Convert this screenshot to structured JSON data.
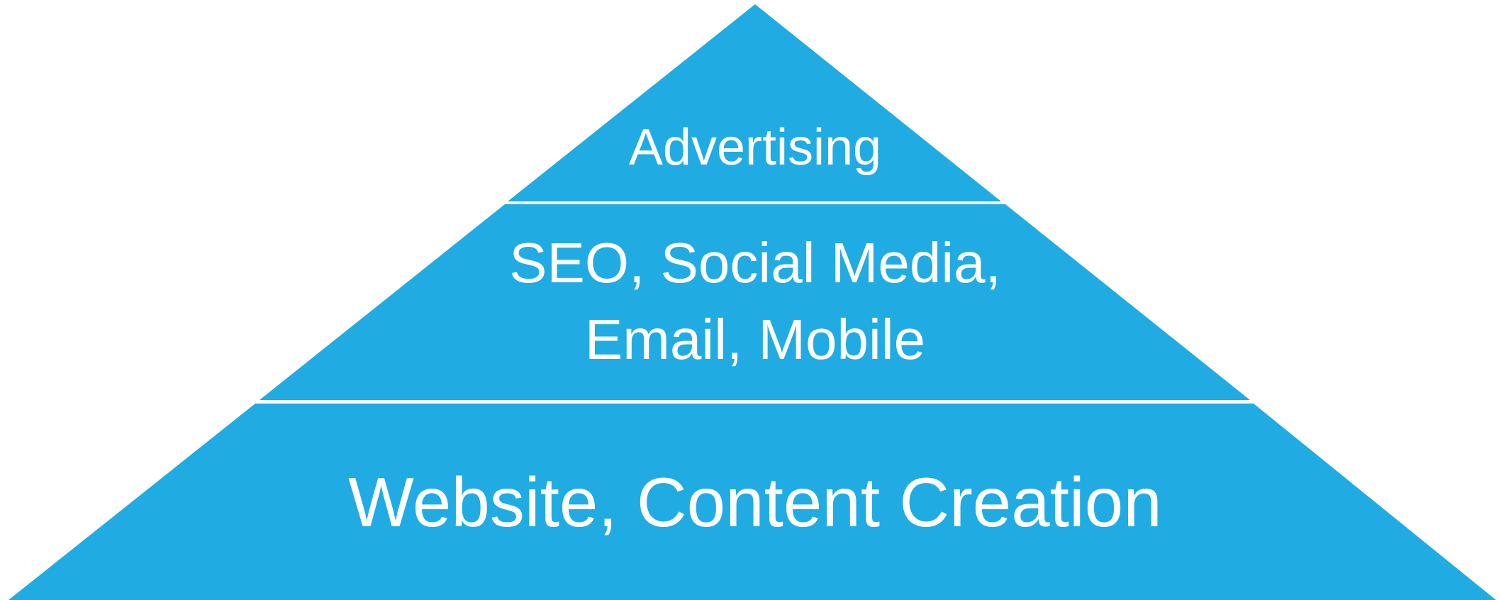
{
  "colors": {
    "tier_fill": "#20ace2",
    "separator": "#ffffff",
    "label": "#ffffff",
    "background": "#ffffff"
  },
  "pyramid": {
    "tiers": [
      {
        "lines": [
          "Advertising"
        ]
      },
      {
        "lines": [
          "SEO, Social Media,",
          "Email, Mobile"
        ]
      },
      {
        "lines": [
          "Website, Content Creation"
        ]
      }
    ]
  }
}
